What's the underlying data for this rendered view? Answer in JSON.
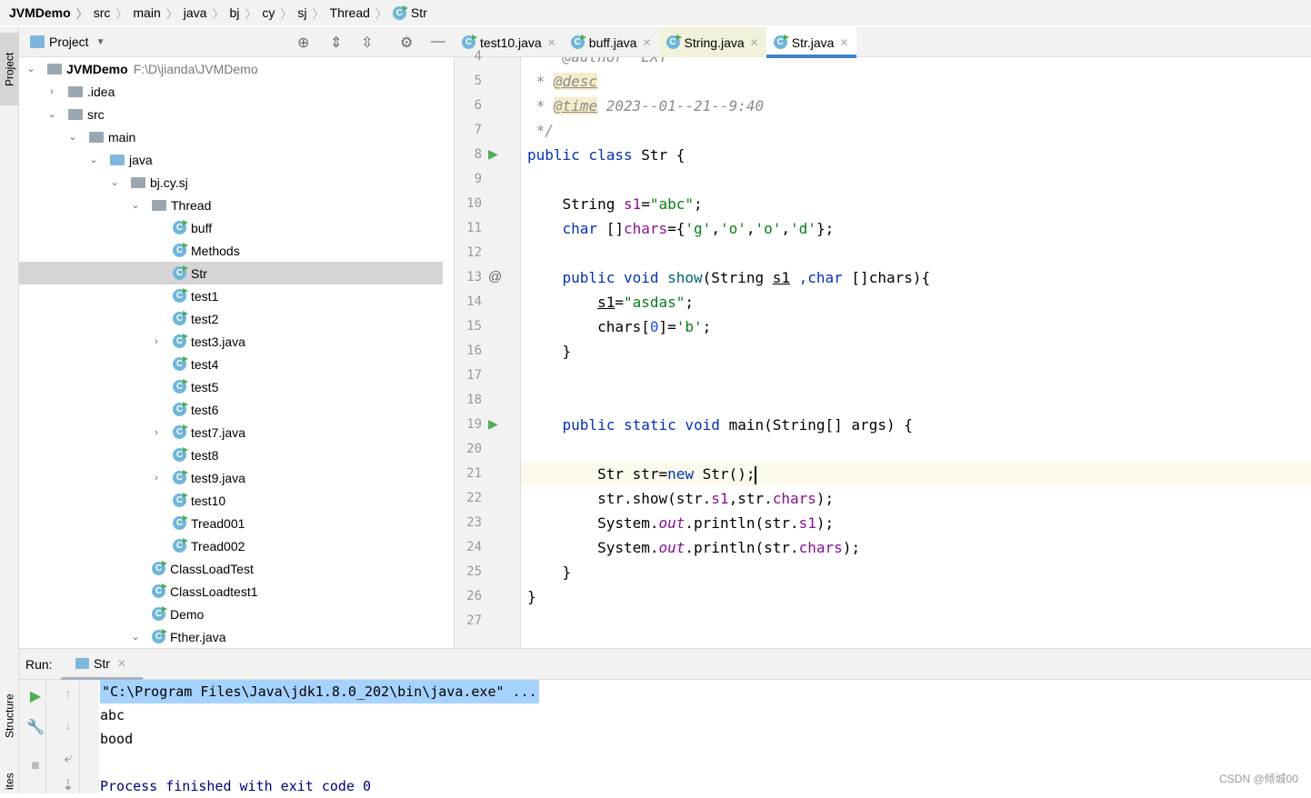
{
  "breadcrumb": [
    "JVMDemo",
    "src",
    "main",
    "java",
    "bj",
    "cy",
    "sj",
    "Thread",
    "Str"
  ],
  "sidebar_tabs": {
    "project": "Project",
    "structure": "Structure",
    "favorites": "ites"
  },
  "project_panel": {
    "title": "Project",
    "root": {
      "name": "JVMDemo",
      "path": "F:\\D\\jianda\\JVMDemo"
    },
    "items": [
      {
        "label": ".idea",
        "level": 1,
        "type": "folder",
        "expanded": false
      },
      {
        "label": "src",
        "level": 1,
        "type": "folder",
        "expanded": true
      },
      {
        "label": "main",
        "level": 2,
        "type": "folder",
        "expanded": true
      },
      {
        "label": "java",
        "level": 3,
        "type": "folder-blue",
        "expanded": true
      },
      {
        "label": "bj.cy.sj",
        "level": 4,
        "type": "package",
        "expanded": true
      },
      {
        "label": "Thread",
        "level": 5,
        "type": "package",
        "expanded": true
      },
      {
        "label": "buff",
        "level": 6,
        "type": "class"
      },
      {
        "label": "Methods",
        "level": 6,
        "type": "class"
      },
      {
        "label": "Str",
        "level": 6,
        "type": "class",
        "selected": true
      },
      {
        "label": "test1",
        "level": 6,
        "type": "class"
      },
      {
        "label": "test2",
        "level": 6,
        "type": "class"
      },
      {
        "label": "test3.java",
        "level": 6,
        "type": "class",
        "expanded": false
      },
      {
        "label": "test4",
        "level": 6,
        "type": "class"
      },
      {
        "label": "test5",
        "level": 6,
        "type": "class"
      },
      {
        "label": "test6",
        "level": 6,
        "type": "class"
      },
      {
        "label": "test7.java",
        "level": 6,
        "type": "class",
        "expanded": false
      },
      {
        "label": "test8",
        "level": 6,
        "type": "class"
      },
      {
        "label": "test9.java",
        "level": 6,
        "type": "class",
        "expanded": false
      },
      {
        "label": "test10",
        "level": 6,
        "type": "class"
      },
      {
        "label": "Tread001",
        "level": 6,
        "type": "class"
      },
      {
        "label": "Tread002",
        "level": 6,
        "type": "class"
      },
      {
        "label": "ClassLoadTest",
        "level": 5,
        "type": "class"
      },
      {
        "label": "ClassLoadtest1",
        "level": 5,
        "type": "class"
      },
      {
        "label": "Demo",
        "level": 5,
        "type": "class"
      },
      {
        "label": "Fther.java",
        "level": 5,
        "type": "class",
        "expanded": true
      }
    ]
  },
  "editor_tabs": [
    {
      "label": "test10.java"
    },
    {
      "label": "buff.java"
    },
    {
      "label": "String.java",
      "style": "yellow"
    },
    {
      "label": "Str.java",
      "active": true
    }
  ],
  "code": {
    "first_line": 4,
    "current_line": 21,
    "lines": [
      [
        [
          "cm",
          "    @author  LXY"
        ]
      ],
      [
        [
          "cm",
          " * "
        ],
        [
          "tag",
          "@desc"
        ]
      ],
      [
        [
          "cm",
          " * "
        ],
        [
          "tag",
          "@time"
        ],
        [
          "cm",
          " 2023--01--21--9:40"
        ]
      ],
      [
        [
          "cm",
          " */"
        ]
      ],
      [
        [
          "kw",
          "public class "
        ],
        [
          "",
          "Str {"
        ]
      ],
      [],
      [
        [
          "",
          "    String "
        ],
        [
          "fld",
          "s1"
        ],
        [
          "",
          "="
        ],
        [
          "str",
          "\"abc\""
        ],
        [
          "",
          ";"
        ]
      ],
      [
        [
          "kw",
          "    char "
        ],
        [
          "",
          "[]"
        ],
        [
          "fld",
          "chars"
        ],
        [
          "",
          "={"
        ],
        [
          "str",
          "'g'"
        ],
        [
          "",
          ","
        ],
        [
          "str",
          "'o'"
        ],
        [
          "",
          ","
        ],
        [
          "str",
          "'o'"
        ],
        [
          "",
          ","
        ],
        [
          "str",
          "'d'"
        ],
        [
          "",
          "};"
        ]
      ],
      [],
      [
        [
          "kw",
          "    public void "
        ],
        [
          "fn",
          "show"
        ],
        [
          "",
          "(String "
        ],
        [
          "ul",
          "s1"
        ],
        [
          "kw",
          " ,char "
        ],
        [
          "",
          "[]chars){"
        ]
      ],
      [
        [
          "",
          "        "
        ],
        [
          "ul",
          "s1"
        ],
        [
          "",
          "="
        ],
        [
          "str",
          "\"asdas\""
        ],
        [
          "",
          ";"
        ]
      ],
      [
        [
          "",
          "        chars["
        ],
        [
          "num",
          "0"
        ],
        [
          "",
          "]="
        ],
        [
          "str",
          "'b'"
        ],
        [
          "",
          ";"
        ]
      ],
      [
        [
          "",
          "    }"
        ]
      ],
      [],
      [],
      [
        [
          "kw",
          "    public static void "
        ],
        [
          "",
          "main(String[] args) {"
        ]
      ],
      [],
      [
        [
          "",
          "        Str str="
        ],
        [
          "kw",
          "new "
        ],
        [
          "",
          "Str();"
        ]
      ],
      [
        [
          "",
          "        str.show(str."
        ],
        [
          "fld",
          "s1"
        ],
        [
          "",
          ",str."
        ],
        [
          "fld",
          "chars"
        ],
        [
          "",
          ");"
        ]
      ],
      [
        [
          "",
          "        System."
        ],
        [
          "st",
          "out"
        ],
        [
          "",
          ".println(str."
        ],
        [
          "fld",
          "s1"
        ],
        [
          "",
          ");"
        ]
      ],
      [
        [
          "",
          "        System."
        ],
        [
          "st",
          "out"
        ],
        [
          "",
          ".println(str."
        ],
        [
          "fld",
          "chars"
        ],
        [
          "",
          ");"
        ]
      ],
      [
        [
          "",
          "    }"
        ]
      ],
      [
        [
          "",
          "}"
        ]
      ],
      []
    ]
  },
  "run": {
    "label": "Run:",
    "tab": "Str",
    "output": [
      "\"C:\\Program Files\\Java\\jdk1.8.0_202\\bin\\java.exe\" ...",
      "abc",
      "bood",
      "",
      "Process finished with exit code 0"
    ]
  },
  "watermark": "CSDN @倾城00",
  "colors": {
    "accent": "#4083c9",
    "keyword": "#0033b3",
    "string": "#067d17",
    "field": "#871094"
  }
}
